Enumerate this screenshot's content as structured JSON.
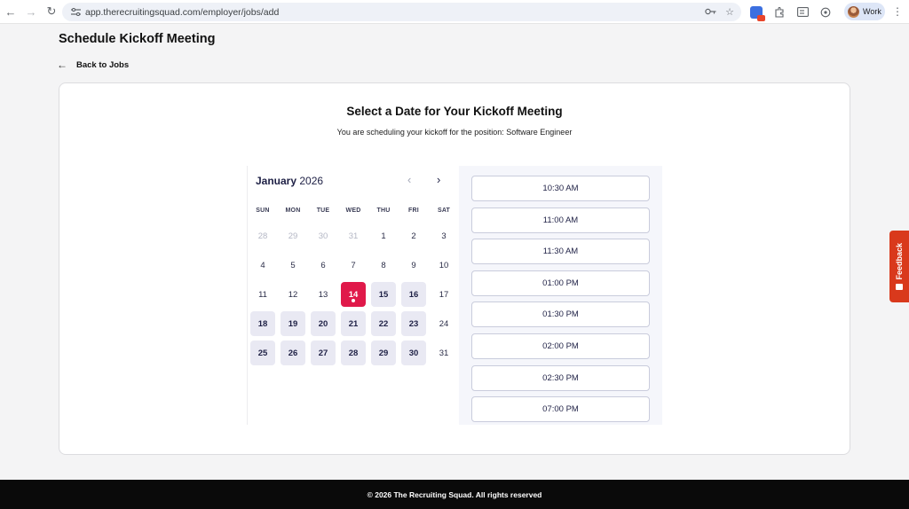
{
  "browser": {
    "url": "app.therecruitingsquad.com/employer/jobs/add",
    "profile_label": "Work"
  },
  "page": {
    "title": "Schedule Kickoff Meeting",
    "back_label": "Back to Jobs"
  },
  "card": {
    "title": "Select a Date for Your Kickoff Meeting",
    "subtitle": "You are scheduling your kickoff for the position: Software Engineer"
  },
  "calendar": {
    "month": "January",
    "year": "2026",
    "weekdays": [
      "SUN",
      "MON",
      "TUE",
      "WED",
      "THU",
      "FRI",
      "SAT"
    ],
    "weeks": [
      [
        {
          "d": "28",
          "s": "muted"
        },
        {
          "d": "29",
          "s": "muted"
        },
        {
          "d": "30",
          "s": "muted"
        },
        {
          "d": "31",
          "s": "muted"
        },
        {
          "d": "1",
          "s": "plain"
        },
        {
          "d": "2",
          "s": "plain"
        },
        {
          "d": "3",
          "s": "plain"
        }
      ],
      [
        {
          "d": "4",
          "s": "plain"
        },
        {
          "d": "5",
          "s": "plain"
        },
        {
          "d": "6",
          "s": "plain"
        },
        {
          "d": "7",
          "s": "plain"
        },
        {
          "d": "8",
          "s": "plain"
        },
        {
          "d": "9",
          "s": "plain"
        },
        {
          "d": "10",
          "s": "plain"
        }
      ],
      [
        {
          "d": "11",
          "s": "plain"
        },
        {
          "d": "12",
          "s": "plain"
        },
        {
          "d": "13",
          "s": "plain"
        },
        {
          "d": "14",
          "s": "selected"
        },
        {
          "d": "15",
          "s": "avail"
        },
        {
          "d": "16",
          "s": "avail"
        },
        {
          "d": "17",
          "s": "plain"
        }
      ],
      [
        {
          "d": "18",
          "s": "avail"
        },
        {
          "d": "19",
          "s": "avail"
        },
        {
          "d": "20",
          "s": "avail"
        },
        {
          "d": "21",
          "s": "avail"
        },
        {
          "d": "22",
          "s": "avail"
        },
        {
          "d": "23",
          "s": "avail"
        },
        {
          "d": "24",
          "s": "plain"
        }
      ],
      [
        {
          "d": "25",
          "s": "avail"
        },
        {
          "d": "26",
          "s": "avail"
        },
        {
          "d": "27",
          "s": "avail"
        },
        {
          "d": "28",
          "s": "avail"
        },
        {
          "d": "29",
          "s": "avail"
        },
        {
          "d": "30",
          "s": "avail"
        },
        {
          "d": "31",
          "s": "plain"
        }
      ]
    ]
  },
  "time_slots": [
    "10:30 AM",
    "11:00 AM",
    "11:30 AM",
    "01:00 PM",
    "01:30 PM",
    "02:00 PM",
    "02:30 PM",
    "07:00 PM"
  ],
  "feedback": {
    "label": "Feedback"
  },
  "footer": {
    "text": "© 2026 The Recruiting Squad. All rights reserved"
  },
  "colors": {
    "accent": "#e0194a",
    "feedback": "#d9391c",
    "available": "#e9e9f3"
  }
}
